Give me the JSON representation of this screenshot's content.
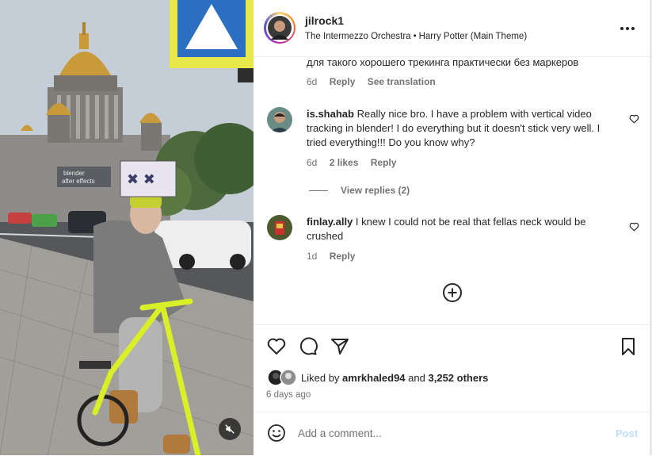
{
  "header": {
    "username": "jilrock1",
    "artist": "The Intermezzo Orchestra",
    "separator": "•",
    "song": "Harry Potter (Main Theme)"
  },
  "media": {
    "overlay_text": "blender\nafter effects"
  },
  "comments": [
    {
      "text": "для такого хорошего трекинга практически без маркеров",
      "time": "6d",
      "reply": "Reply",
      "translation": "See translation"
    },
    {
      "user": "is.shahab",
      "text": "Really nice bro. I have a problem with vertical video tracking in blender! I do everything but it doesn't stick very well. I tried everything!!! Do you know why?",
      "time": "6d",
      "likes": "2 likes",
      "reply": "Reply",
      "view_replies": "View replies (2)"
    },
    {
      "user": "finlay.ally",
      "text": "I knew I could not be real that fellas neck would be crushed",
      "time": "1d",
      "reply": "Reply"
    }
  ],
  "likes": {
    "prefix": "Liked by",
    "user": "amrkhaled94",
    "joiner": "and",
    "others": "3,252 others"
  },
  "time_ago": "6 days ago",
  "comment_bar": {
    "placeholder": "Add a comment...",
    "post": "Post"
  },
  "icons": {
    "more": "more-horizontal-icon",
    "like": "heart-icon",
    "comment": "comment-bubble-icon",
    "share": "paper-plane-icon",
    "save": "bookmark-icon",
    "emoji": "smiley-icon",
    "load_more": "plus-circle-icon",
    "mute": "speaker-muted-icon"
  },
  "colors": {
    "text": "#262626",
    "secondary": "#737373",
    "post_disabled": "#c0dffd",
    "border": "#efefef"
  }
}
